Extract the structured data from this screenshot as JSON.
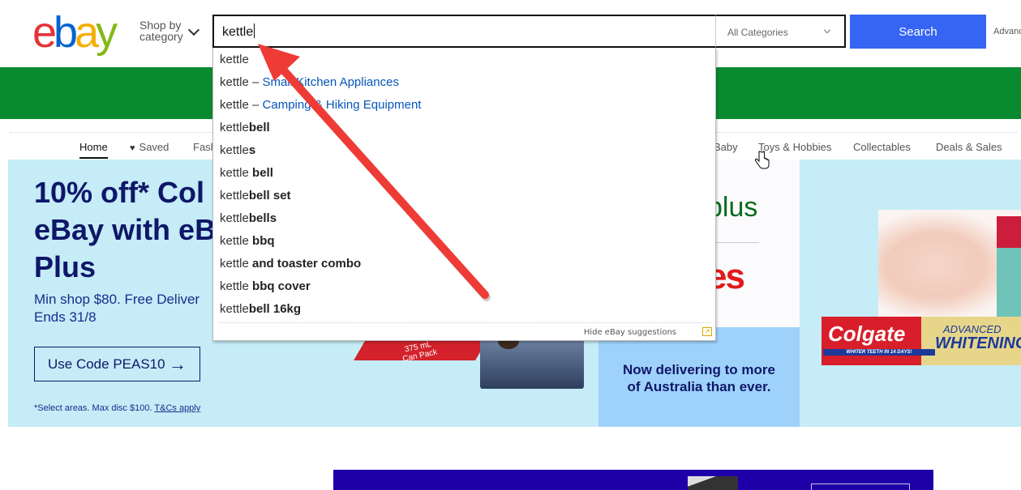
{
  "header": {
    "logo": [
      "e",
      "b",
      "a",
      "y"
    ],
    "shop_by_category_line1": "Shop by",
    "shop_by_category_line2": "category",
    "search_value": "kettle",
    "category_selected": "All Categories",
    "search_button": "Search",
    "advanced_link": "Advanced"
  },
  "colors": {
    "search_button": "#3665f3",
    "green_band": "#0a8a2e",
    "hero_bg": "#c5ecf7",
    "hero_text": "#0f1768",
    "annotation_arrow": "#ef3b36"
  },
  "nav": {
    "items": [
      {
        "label": "Home",
        "active": true
      },
      {
        "label": "Saved",
        "icon": "heart-icon"
      },
      {
        "label": "Fashion"
      },
      {
        "label": "Baby"
      },
      {
        "label": "Toys & Hobbies"
      },
      {
        "label": "Collectables"
      },
      {
        "label": "Deals & Sales"
      }
    ],
    "fashion_visible": "Fash",
    "baby_visible": "Baby"
  },
  "autocomplete": {
    "suggestions": [
      {
        "prefix": "kettle",
        "suffix": "",
        "category": ""
      },
      {
        "prefix": "kettle – ",
        "suffix": "",
        "category": "Small Kitchen Appliances"
      },
      {
        "prefix": "kettle – ",
        "suffix": "",
        "category": "Camping & Hiking Equipment"
      },
      {
        "prefix": "kettle",
        "suffix": "bell",
        "category": ""
      },
      {
        "prefix": "kettle",
        "suffix": "s",
        "category": ""
      },
      {
        "prefix": "kettle ",
        "suffix": "bell",
        "category": ""
      },
      {
        "prefix": "kettle",
        "suffix": "bell set",
        "category": ""
      },
      {
        "prefix": "kettle",
        "suffix": "bells",
        "category": ""
      },
      {
        "prefix": "kettle ",
        "suffix": "bbq",
        "category": ""
      },
      {
        "prefix": "kettle ",
        "suffix": "and toaster combo",
        "category": ""
      },
      {
        "prefix": "kettle ",
        "suffix": "bbq cover",
        "category": ""
      },
      {
        "prefix": "kettle",
        "suffix": "bell 16kg",
        "category": ""
      }
    ],
    "hide_link": "Hide eBay suggestions"
  },
  "hero": {
    "title": "10% off* Col\neBay with eB\nPlus",
    "subtitle": "Min shop $80. Free Deliver\nEnds 31/8",
    "code_button": "Use Code PEAS10",
    "fine_print": "*Select areas. Max disc $100.",
    "terms_link": "T&Cs apply",
    "product_can_text": "375 mL\nCan Pack",
    "plus_fragment": "plus",
    "es_fragment": "es",
    "delivery_text": "Now delivering to more\nof Australia than ever.",
    "colgate_brand": "Colgate",
    "colgate_tagline": "WHITER TEETH IN 14 DAYS!",
    "colgate_advanced": "ADVANCED",
    "colgate_whitening": "WHITENING"
  }
}
